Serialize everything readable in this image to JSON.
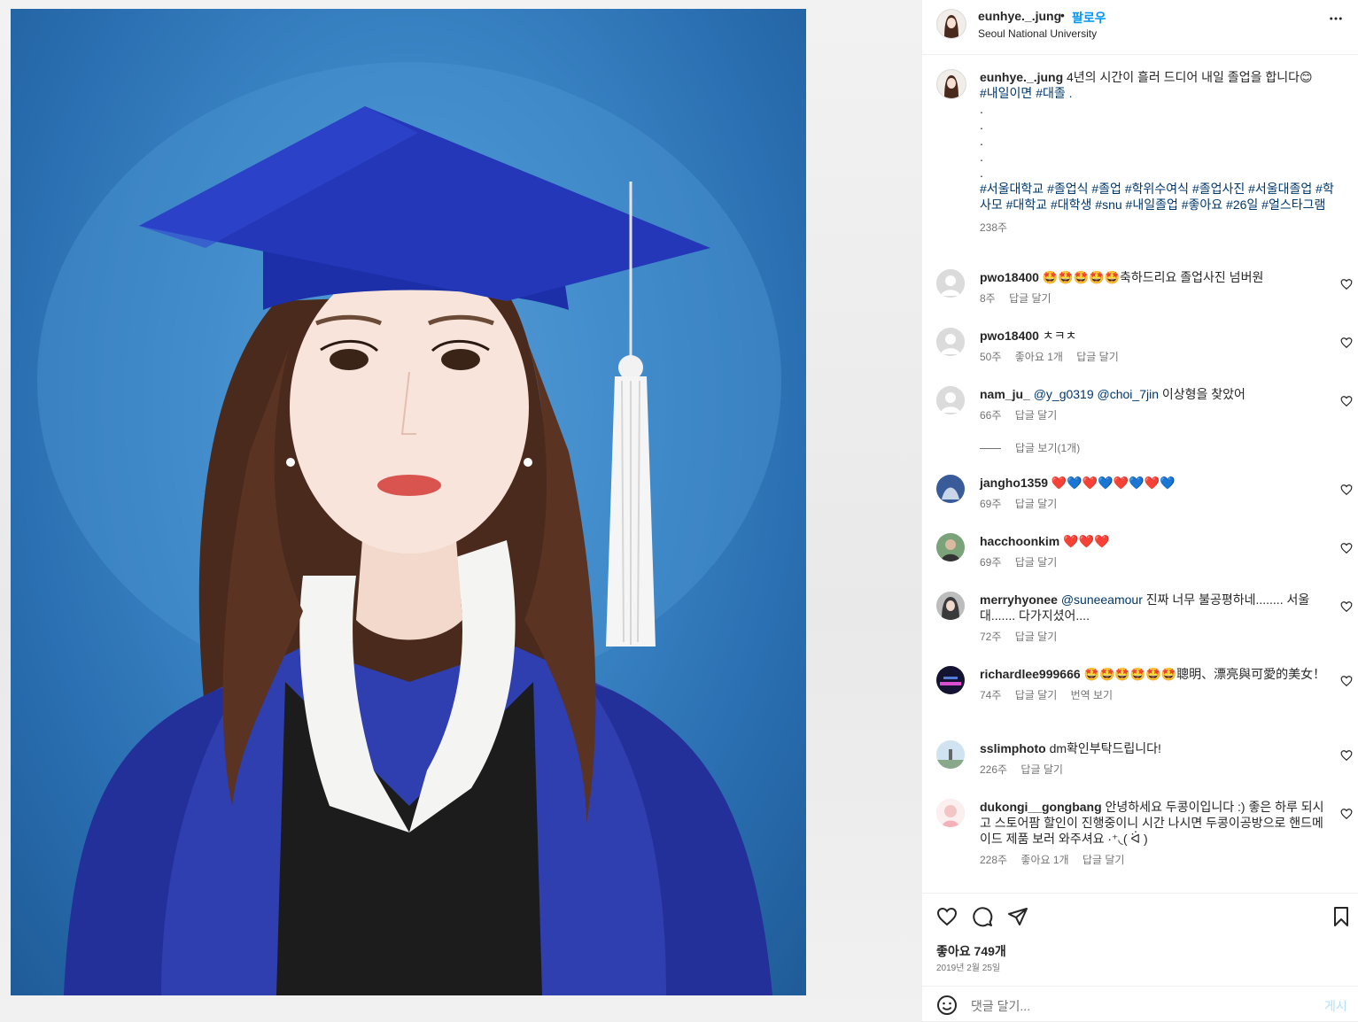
{
  "header": {
    "username": "eunhye._.jung",
    "separator": "•",
    "follow_label": "팔로우",
    "location": "Seoul National University",
    "more_icon": "more-horizontal-icon"
  },
  "caption": {
    "username": "eunhye._.jung",
    "text": "4년의 시간이 흘러 드디어 내일 졸업을 합니다😊",
    "tags_line1": "#내일이면 #대졸 .",
    "dots": [
      ".",
      ".",
      ".",
      ".",
      "."
    ],
    "tags_line2": "#서울대학교 #졸업식 #졸업 #학위수여식 #졸업사진 #서울대졸업 #학사모 #대학교 #대학생 #snu #내일졸업 #좋아요 #26일 #얼스타그램",
    "time": "238주"
  },
  "comments": [
    {
      "username": "pwo18400",
      "text": "🤩🤩🤩🤩🤩축하드리요 졸업사진 넘버원",
      "time": "8주",
      "likes": "",
      "reply": "답글 달기"
    },
    {
      "username": "pwo18400",
      "text": "ㅊㅋㅊ",
      "time": "50주",
      "likes": "좋아요 1개",
      "reply": "답글 달기"
    },
    {
      "username": "nam_ju_",
      "mention": "@y_g0319 @choi_7jin",
      "text": "이상형을 찾았어",
      "time": "66주",
      "likes": "",
      "reply": "답글 달기"
    },
    {
      "username": "jangho1359",
      "text": "❤️💙❤️💙❤️💙❤️💙",
      "time": "69주",
      "likes": "",
      "reply": "답글 달기"
    },
    {
      "username": "hacchoonkim",
      "text": "❤️❤️❤️",
      "time": "69주",
      "likes": "",
      "reply": "답글 달기"
    },
    {
      "username": "merryhyonee",
      "mention": "@suneeamour",
      "text": "진짜 너무 불공평하네........ 서울대....... 다가지셨어....",
      "time": "72주",
      "likes": "",
      "reply": "답글 달기"
    },
    {
      "username": "richardlee999666",
      "text": "🤩🤩🤩🤩🤩🤩聰明、漂亮與可愛的美女！",
      "time": "74주",
      "likes": "",
      "reply": "답글 달기",
      "translate": "번역 보기"
    },
    {
      "username": "sslimphoto",
      "text": "dm확인부탁드립니다!",
      "time": "226주",
      "likes": "",
      "reply": "답글 달기"
    },
    {
      "username": "dukongi__gongbang",
      "text": "안녕하세요 두콩이입니다 :) 좋은 하루 되시고 스토어팜 할인이 진행중이니 시간 나시면 두콩이공방으로 핸드메이드 제품 보러 와주셔요 ·⁺◟( ᐛ )",
      "time": "228주",
      "likes": "좋아요 1개",
      "reply": "답글 달기"
    }
  ],
  "view_replies": "답글 보기(1개)",
  "actions": {
    "like_icon": "heart-icon",
    "comment_icon": "comment-icon",
    "share_icon": "send-icon",
    "save_icon": "bookmark-icon",
    "likes_text": "좋아요 749개",
    "date": "2019년 2월 25일"
  },
  "composer": {
    "emoji_icon": "smile-icon",
    "placeholder": "댓글 달기...",
    "post_label": "게시"
  },
  "colors": {
    "link": "#0095f6",
    "hashtag": "#00376b",
    "secondary": "#737373"
  }
}
